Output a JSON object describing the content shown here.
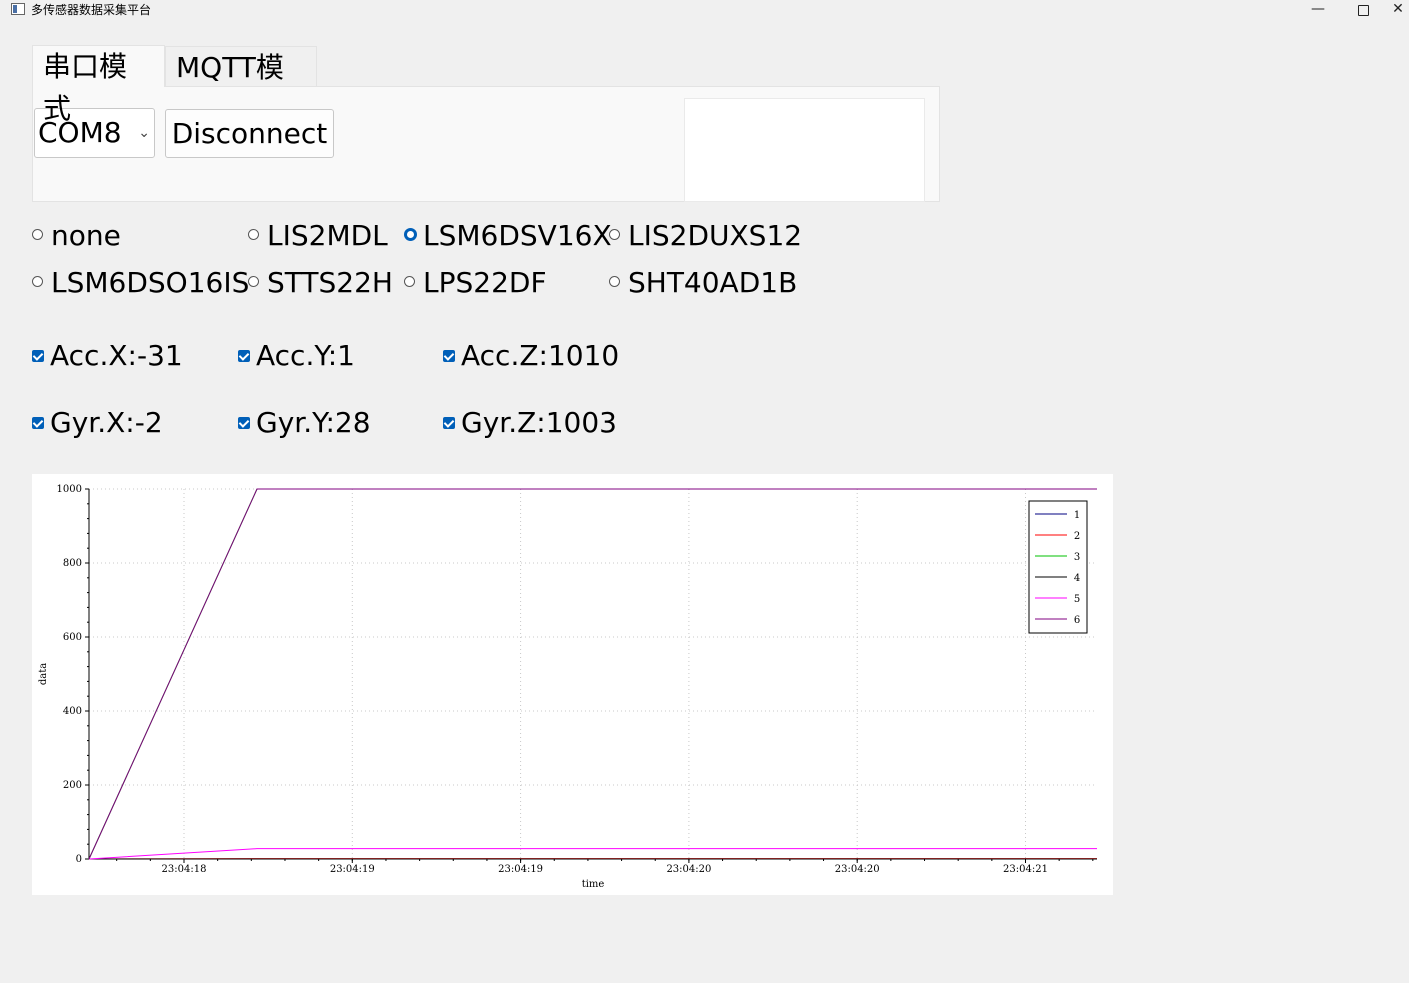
{
  "window": {
    "title": "多传感器数据采集平台",
    "minimize": "—",
    "close": "✕"
  },
  "tabs": [
    {
      "label": "串口模式"
    },
    {
      "label": "MQTT模式"
    }
  ],
  "serial": {
    "port": "COM8",
    "button": "Disconnect"
  },
  "sensors": {
    "options": [
      "none",
      "LIS2MDL",
      "LSM6DSV16X",
      "LIS2DUXS12",
      "LSM6DSO16IS",
      "STTS22H",
      "LPS22DF",
      "SHT40AD1B"
    ],
    "selected": "LSM6DSV16X"
  },
  "readings": {
    "acc_x": "Acc.X:-31",
    "acc_y": "Acc.Y:1",
    "acc_z": "Acc.Z:1010",
    "gyr_x": "Gyr.X:-2",
    "gyr_y": "Gyr.Y:28",
    "gyr_z": "Gyr.Z:1003"
  },
  "chart_data": {
    "type": "line",
    "xlabel": "time",
    "ylabel": "data",
    "ylim": [
      0,
      1000
    ],
    "y_ticks": [
      0,
      200,
      400,
      600,
      800,
      1000
    ],
    "x_tick_labels": [
      "23:04:18",
      "23:04:19",
      "23:04:19",
      "23:04:20",
      "23:04:20",
      "23:04:21"
    ],
    "grid": true,
    "legend": "top-right",
    "series": [
      {
        "name": "1",
        "color": "#000080",
        "values": [
          0,
          -31,
          -31,
          -31,
          -31,
          -31,
          -31,
          -31
        ]
      },
      {
        "name": "2",
        "color": "#ff0000",
        "values": [
          0,
          1,
          1,
          1,
          1,
          1,
          1,
          1
        ]
      },
      {
        "name": "3",
        "color": "#00c000",
        "values": [
          0,
          1010,
          1010,
          1010,
          1010,
          1010,
          1010,
          1010
        ]
      },
      {
        "name": "4",
        "color": "#000000",
        "values": [
          0,
          -2,
          -2,
          -2,
          -2,
          -2,
          -2,
          -2
        ]
      },
      {
        "name": "5",
        "color": "#ff00ff",
        "values": [
          0,
          28,
          28,
          28,
          28,
          28,
          28,
          28
        ]
      },
      {
        "name": "6",
        "color": "#800080",
        "values": [
          0,
          1003,
          1003,
          1003,
          1003,
          1003,
          1003,
          1003
        ]
      }
    ]
  }
}
